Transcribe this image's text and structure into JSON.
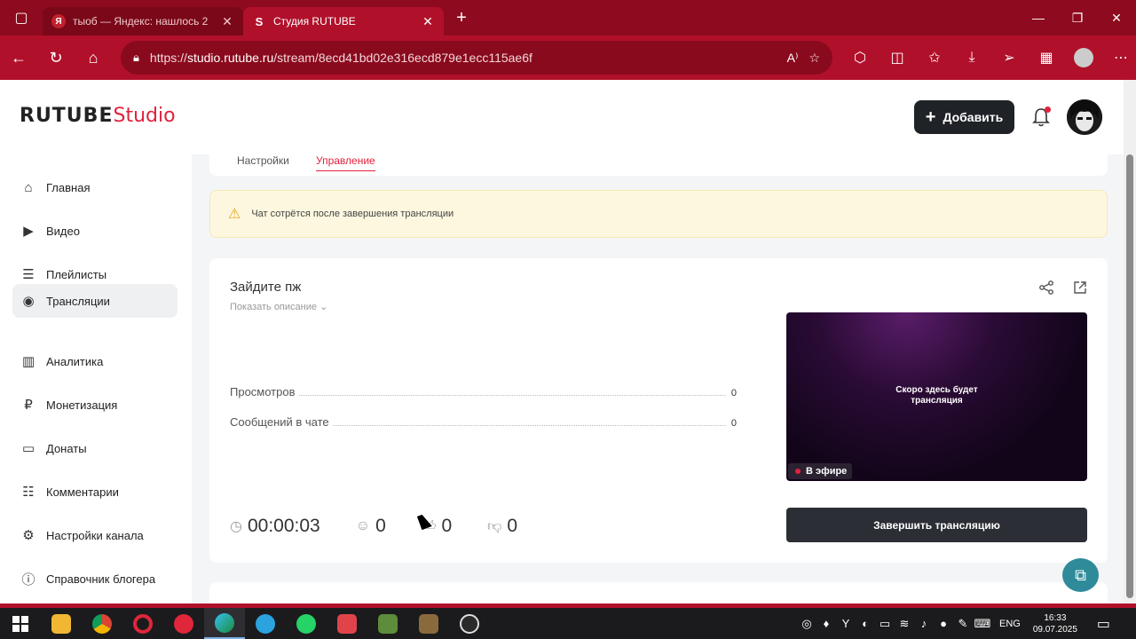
{
  "browser": {
    "tabs": [
      {
        "title": "тыоб — Яндекс: нашлось 2",
        "active": false,
        "favicon": "yandex-icon"
      },
      {
        "title": "Студия RUTUBE",
        "active": true,
        "favicon": "rutube-icon"
      }
    ],
    "url_prefix": "https://",
    "url_host": "studio.rutube.ru",
    "url_path": "/stream/8ecd41bd02e316ecd879e1ecc115ae6f",
    "read_aloud": "A⁾"
  },
  "header": {
    "logo_main": "RUTUBE",
    "logo_studio": "Studio",
    "add_label": "Добавить"
  },
  "sidebar": {
    "items": [
      {
        "label": "Главная",
        "icon": "home-icon",
        "glyph": "⌂"
      },
      {
        "label": "Видео",
        "icon": "video-icon",
        "glyph": "▶"
      },
      {
        "label": "Плейлисты",
        "icon": "playlist-icon",
        "glyph": "☰"
      },
      {
        "label": "Трансляции",
        "icon": "broadcast-icon",
        "glyph": "((·))"
      },
      {
        "label": "Аналитика",
        "icon": "analytics-icon",
        "glyph": "▥"
      },
      {
        "label": "Монетизация",
        "icon": "ruble-icon",
        "glyph": "₽"
      },
      {
        "label": "Донаты",
        "icon": "donate-icon",
        "glyph": "▭"
      },
      {
        "label": "Комментарии",
        "icon": "comments-icon",
        "glyph": "☷"
      },
      {
        "label": "Настройки канала",
        "icon": "settings-icon",
        "glyph": "⚙"
      },
      {
        "label": "Справочник блогера",
        "icon": "info-icon",
        "glyph": "ⓘ"
      }
    ],
    "active_index": 3
  },
  "tabs": {
    "settings": "Настройки",
    "management": "Управление"
  },
  "warning": {
    "text": "Чат сотрётся после завершения трансляции"
  },
  "stream": {
    "title": "Зайдите пж",
    "show_description": "Показать описание",
    "stats": [
      {
        "label": "Просмотров",
        "value": "0"
      },
      {
        "label": "Сообщений в чате",
        "value": "0"
      }
    ],
    "duration": "00:00:03",
    "viewers": "0",
    "likes": "0",
    "dislikes": "0",
    "preview_text_line1": "Скоро здесь будет",
    "preview_text_line2": "трансляция",
    "live_badge": "В эфире",
    "end_button": "Завершить трансляцию"
  },
  "taskbar": {
    "lang": "ENG",
    "time": "16:33",
    "date": "09.07.2025"
  },
  "colors": {
    "brand_red": "#e1223d",
    "browser_chrome": "#b1102a",
    "dark_button": "#1f2226"
  }
}
